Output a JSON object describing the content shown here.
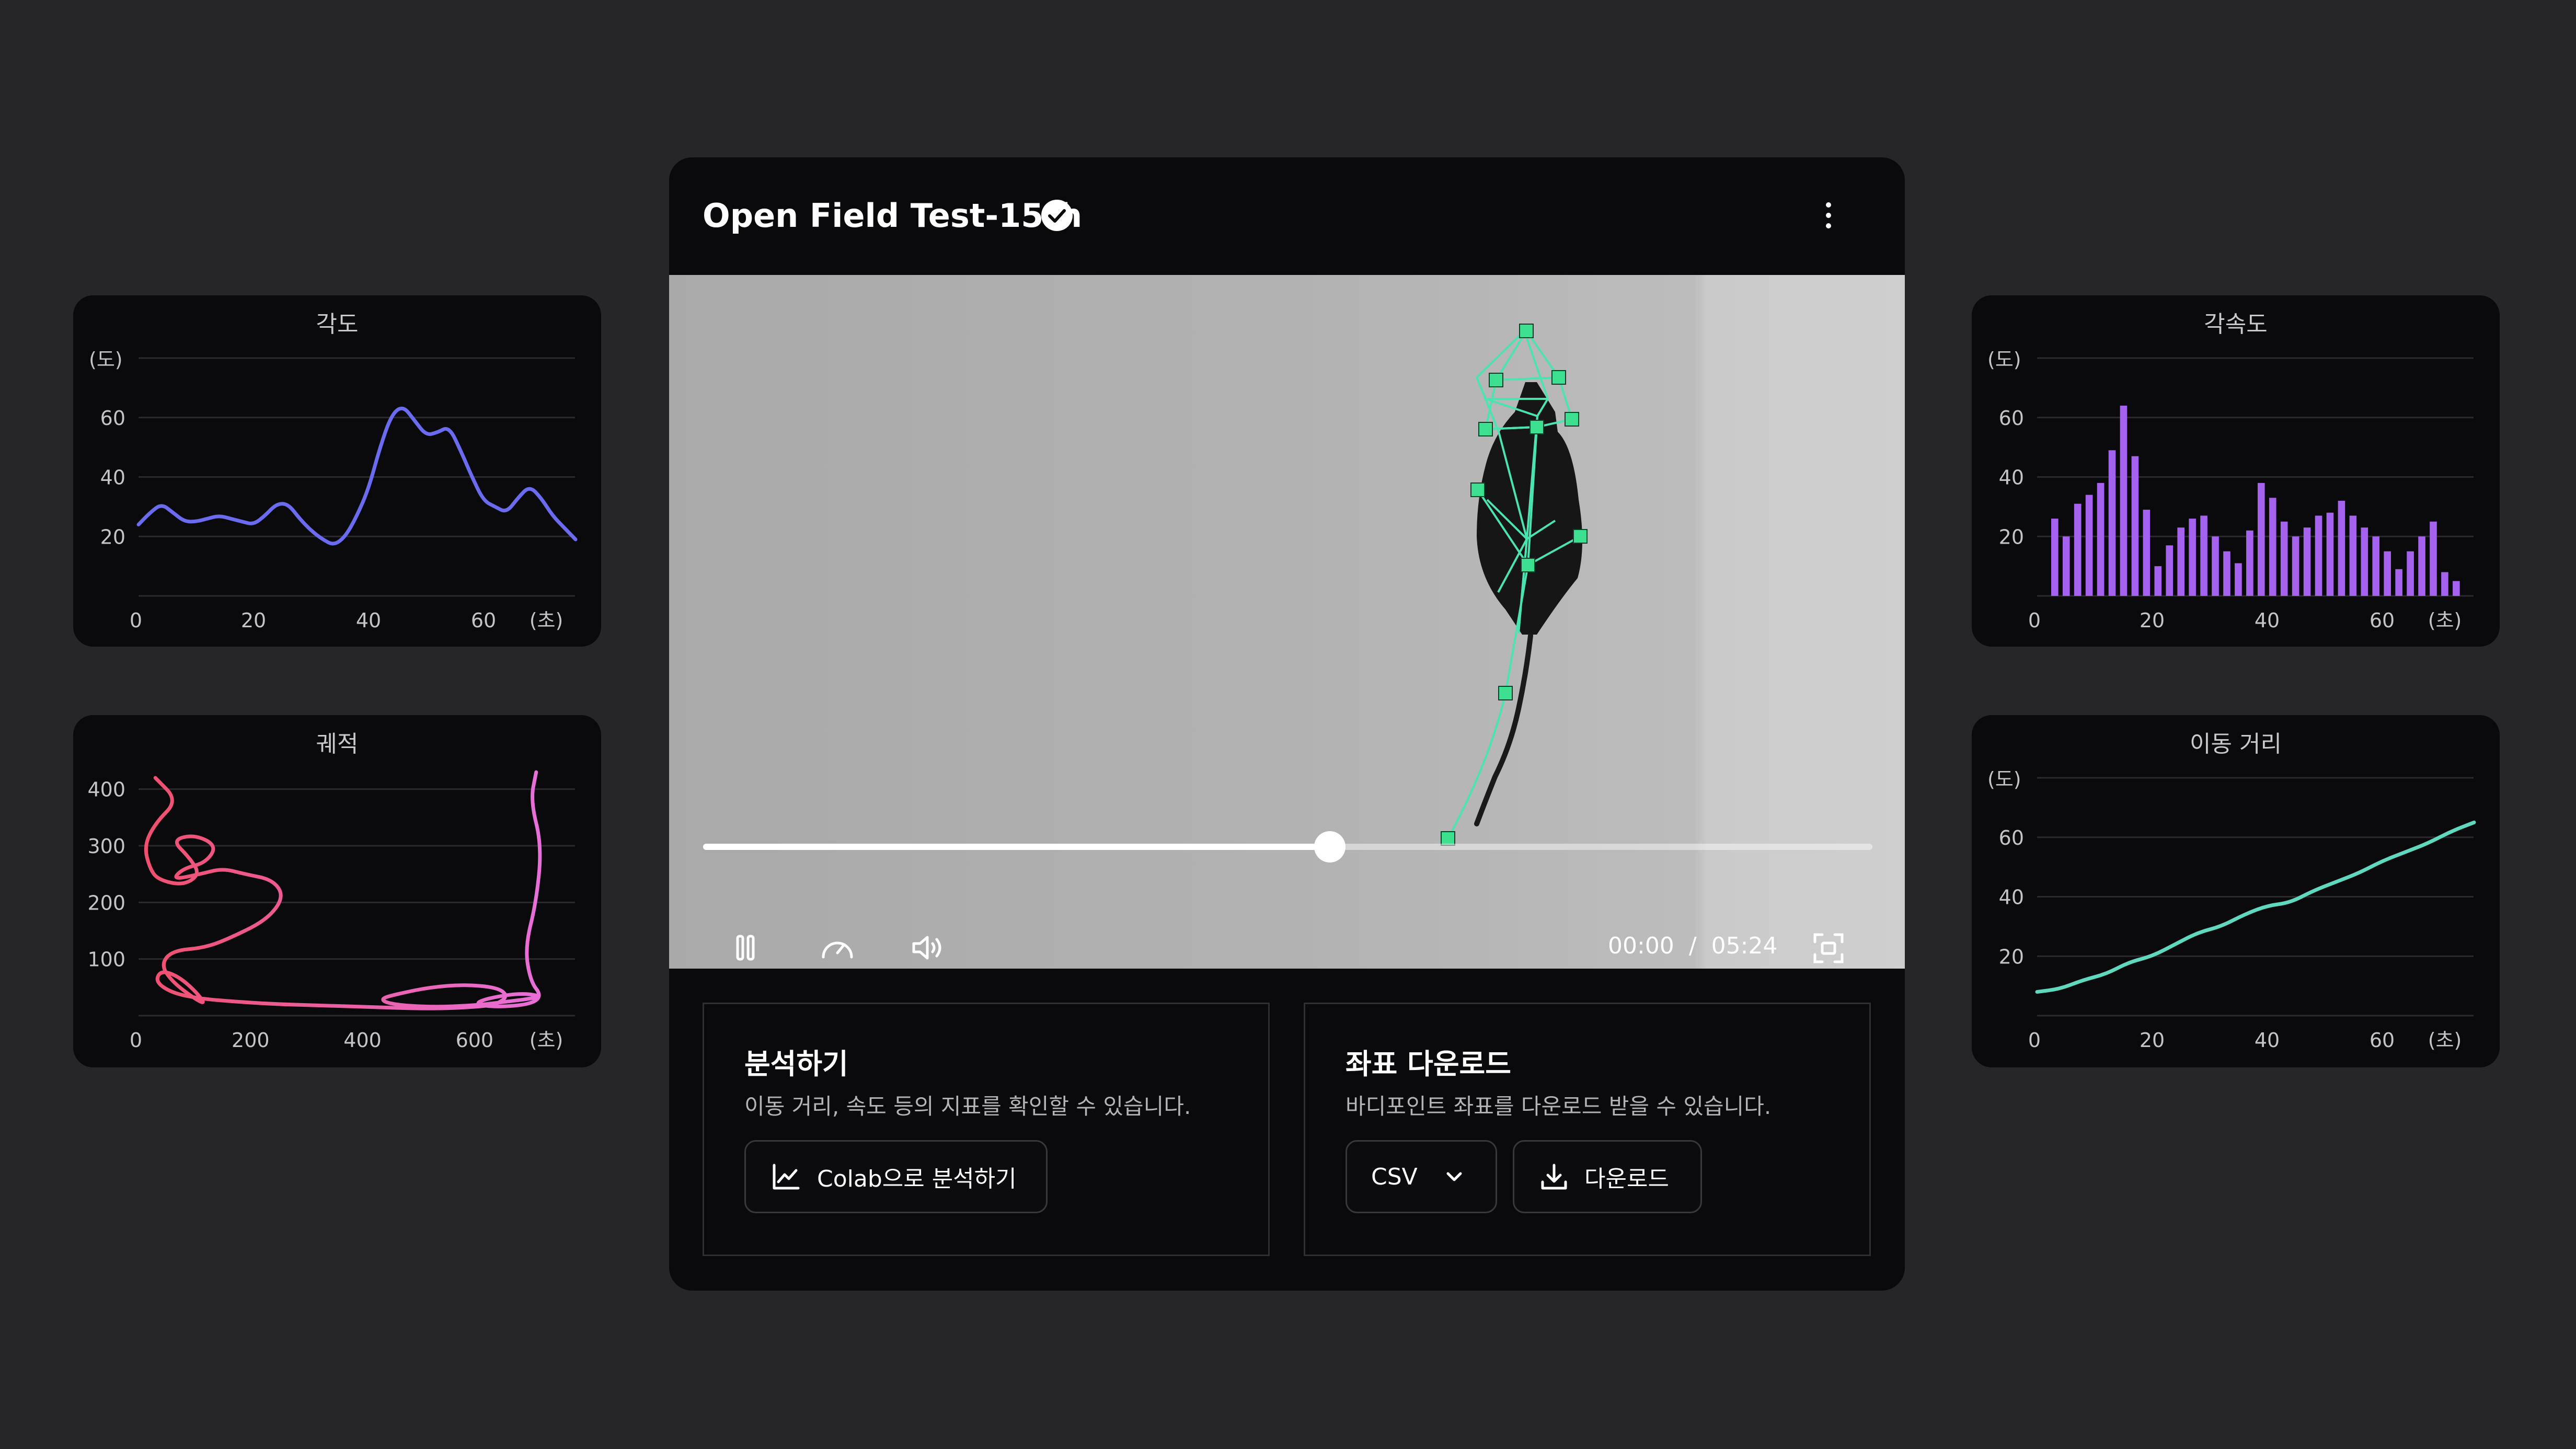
{
  "player": {
    "title": "Open Field Test-15th",
    "current_time": "00:00",
    "time_separator": "/",
    "duration": "05:24",
    "progress": 0.536
  },
  "panels": {
    "analyze": {
      "title": "분석하기",
      "description": "이동 거리, 속도 등의 지표를 확인할 수 있습니다.",
      "button_label": "Colab으로 분석하기"
    },
    "download": {
      "title": "좌표 다운로드",
      "description": "바디포인트 좌표를 다운로드 받을 수 있습니다.",
      "format_value": "CSV",
      "button_label": "다운로드"
    }
  },
  "colors": {
    "angle": "#6b6bf0",
    "trajectory_start": "#f0506e",
    "trajectory_end": "#e86fd9",
    "angular_velocity": "#a562ee",
    "distance": "#5fd8be",
    "keypoint": "#3ce08f"
  },
  "chart_data": [
    {
      "id": "angle",
      "type": "line",
      "title": "각도",
      "ylabel": "(도)",
      "xlabel": "(초)",
      "xlim": [
        0,
        75
      ],
      "ylim": [
        0,
        80
      ],
      "xticks": [
        "0",
        "20",
        "40",
        "60"
      ],
      "yticks": [
        "20",
        "40",
        "60"
      ],
      "x": [
        0,
        2,
        4,
        6,
        8,
        10,
        12,
        14,
        16,
        18,
        20,
        22,
        24,
        26,
        28,
        30,
        32,
        34,
        36,
        38,
        40,
        42,
        44,
        46,
        48,
        50,
        52,
        54,
        56,
        58,
        60,
        62,
        64,
        66,
        68,
        70,
        72,
        74,
        76
      ],
      "values": [
        24,
        28,
        31,
        28,
        25,
        25,
        26,
        27,
        26,
        25,
        24,
        27,
        31,
        31,
        26,
        22,
        19,
        17,
        20,
        27,
        36,
        50,
        61,
        64,
        59,
        54,
        55,
        57,
        49,
        40,
        32,
        30,
        28,
        33,
        37,
        33,
        27,
        23,
        19
      ]
    },
    {
      "id": "trajectory",
      "type": "line",
      "title": "궤적",
      "xlabel": "(초)",
      "xlim": [
        0,
        770
      ],
      "ylim": [
        0,
        420
      ],
      "xticks": [
        "0",
        "200",
        "400",
        "600"
      ],
      "yticks": [
        "100",
        "200",
        "300",
        "400"
      ],
      "x": [
        30,
        70,
        30,
        10,
        20,
        35,
        80,
        110,
        90,
        60,
        100,
        140,
        120,
        80,
        60,
        110,
        150,
        190,
        240,
        260,
        230,
        170,
        120,
        60,
        40,
        60,
        100,
        120,
        100,
        70,
        40,
        30,
        60,
        110,
        170,
        250,
        330,
        420,
        520,
        600,
        640,
        660,
        640,
        580,
        520,
        470,
        430,
        450,
        520,
        600,
        660,
        700,
        720,
        680,
        620,
        600,
        640,
        700,
        720,
        700,
        690,
        710,
        720,
        700,
        710
      ],
      "values": [
        420,
        380,
        340,
        300,
        260,
        240,
        230,
        250,
        280,
        310,
        320,
        300,
        270,
        260,
        240,
        250,
        260,
        250,
        240,
        210,
        170,
        140,
        120,
        115,
        90,
        60,
        30,
        20,
        45,
        70,
        80,
        60,
        40,
        30,
        25,
        20,
        18,
        15,
        12,
        15,
        20,
        35,
        50,
        55,
        50,
        40,
        30,
        20,
        15,
        18,
        25,
        30,
        35,
        40,
        30,
        20,
        15,
        20,
        35,
        60,
        120,
        200,
        300,
        380,
        430
      ]
    },
    {
      "id": "angular_velocity",
      "type": "bar",
      "title": "각속도",
      "ylabel": "(도)",
      "xlabel": "(초)",
      "xlim": [
        0,
        75
      ],
      "ylim": [
        0,
        80
      ],
      "xticks": [
        "0",
        "20",
        "40",
        "60"
      ],
      "yticks": [
        "20",
        "40",
        "60"
      ],
      "values": [
        26,
        20,
        31,
        34,
        38,
        49,
        64,
        47,
        29,
        10,
        17,
        23,
        26,
        27,
        20,
        15,
        11,
        22,
        38,
        33,
        25,
        20,
        23,
        27,
        28,
        32,
        27,
        23,
        20,
        15,
        9,
        15,
        20,
        25,
        8,
        5
      ]
    },
    {
      "id": "distance",
      "type": "line",
      "title": "이동 거리",
      "ylabel": "(도)",
      "xlabel": "(초)",
      "xlim": [
        0,
        75
      ],
      "ylim": [
        0,
        80
      ],
      "xticks": [
        "0",
        "20",
        "40",
        "60"
      ],
      "yticks": [
        "20",
        "40",
        "60"
      ],
      "x": [
        0,
        4,
        8,
        12,
        16,
        20,
        24,
        28,
        32,
        36,
        40,
        44,
        48,
        52,
        56,
        60,
        64,
        68,
        72,
        76
      ],
      "values": [
        8,
        9,
        12,
        14,
        18,
        20,
        24,
        28,
        30,
        34,
        37,
        38,
        42,
        45,
        48,
        52,
        55,
        58,
        62,
        65
      ]
    }
  ]
}
